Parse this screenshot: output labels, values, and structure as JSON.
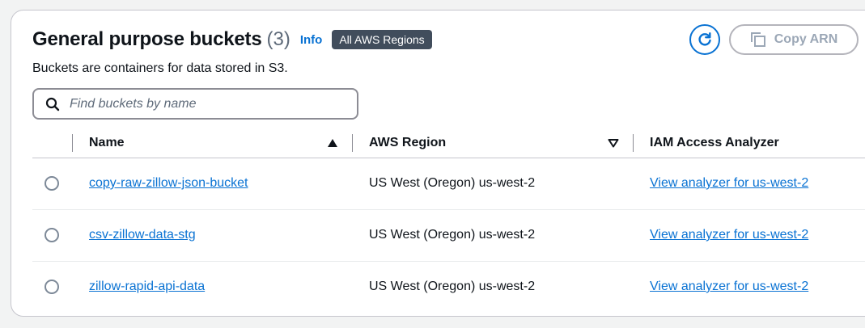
{
  "header": {
    "title": "General purpose buckets",
    "count": "(3)",
    "info_label": "Info",
    "region_badge": "All AWS Regions",
    "description": "Buckets are containers for data stored in S3."
  },
  "actions": {
    "refresh_icon": "refresh-icon",
    "copy_arn_label": "Copy ARN",
    "copy_icon": "copy-icon"
  },
  "search": {
    "placeholder": "Find buckets by name",
    "value": ""
  },
  "table": {
    "columns": [
      "Name",
      "AWS Region",
      "IAM Access Analyzer"
    ],
    "sort": {
      "column": "Name",
      "direction": "ascending"
    },
    "rows": [
      {
        "name": "copy-raw-zillow-json-bucket",
        "region": "US West (Oregon) us-west-2",
        "analyzer": "View analyzer for us-west-2"
      },
      {
        "name": "csv-zillow-data-stg",
        "region": "US West (Oregon) us-west-2",
        "analyzer": "View analyzer for us-west-2"
      },
      {
        "name": "zillow-rapid-api-data",
        "region": "US West (Oregon) us-west-2",
        "analyzer": "View analyzer for us-west-2"
      }
    ]
  },
  "colors": {
    "link": "#0972d3",
    "text": "#0f141a",
    "muted": "#5f6b7a",
    "badge_bg": "#414d5c",
    "disabled": "#9ba7b6"
  }
}
